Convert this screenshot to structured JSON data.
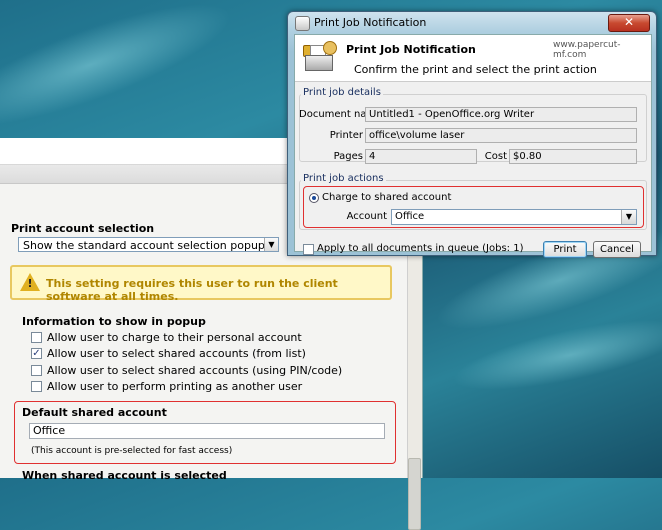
{
  "admin": {
    "print_account_selection": {
      "heading": "Print account selection",
      "selected_option": "Show the standard account selection popup"
    },
    "warning_text": "This setting requires this user to run the client software at all times.",
    "popup_info": {
      "heading": "Information to show in popup",
      "options": [
        {
          "label": "Allow user to charge to their personal account",
          "checked": false
        },
        {
          "label": "Allow user to select shared accounts (from list)",
          "checked": true
        },
        {
          "label": "Allow user to select shared accounts (using PIN/code)",
          "checked": false
        },
        {
          "label": "Allow user to perform printing as another user",
          "checked": false
        }
      ]
    },
    "default_shared_account": {
      "heading": "Default shared account",
      "value": "Office",
      "note": "(This account is pre-selected for fast access)"
    },
    "next_heading": "When shared account is selected"
  },
  "dialog": {
    "window_title": "Print Job Notification",
    "close_symbol": "✕",
    "header_title": "Print Job Notification",
    "header_url": "www.papercut-mf.com",
    "header_subtitle": "Confirm the print and select the print action",
    "details": {
      "group_label": "Print job details",
      "document_label": "Document name",
      "document_value": "Untitled1 - OpenOffice.org Writer",
      "printer_label": "Printer",
      "printer_value": "office\\volume laser",
      "pages_label": "Pages",
      "pages_value": "4",
      "cost_label": "Cost",
      "cost_value": "$0.80"
    },
    "actions": {
      "group_label": "Print job actions",
      "radio_label": "Charge to shared account",
      "account_label": "Account",
      "account_value": "Office"
    },
    "apply_all_label": "Apply to all documents in queue (Jobs: 1)",
    "print_button": "Print",
    "cancel_button": "Cancel"
  },
  "colors": {
    "highlight_red": "#e03030",
    "warning_text": "#b08600",
    "desktop": "#1f6f8a"
  }
}
